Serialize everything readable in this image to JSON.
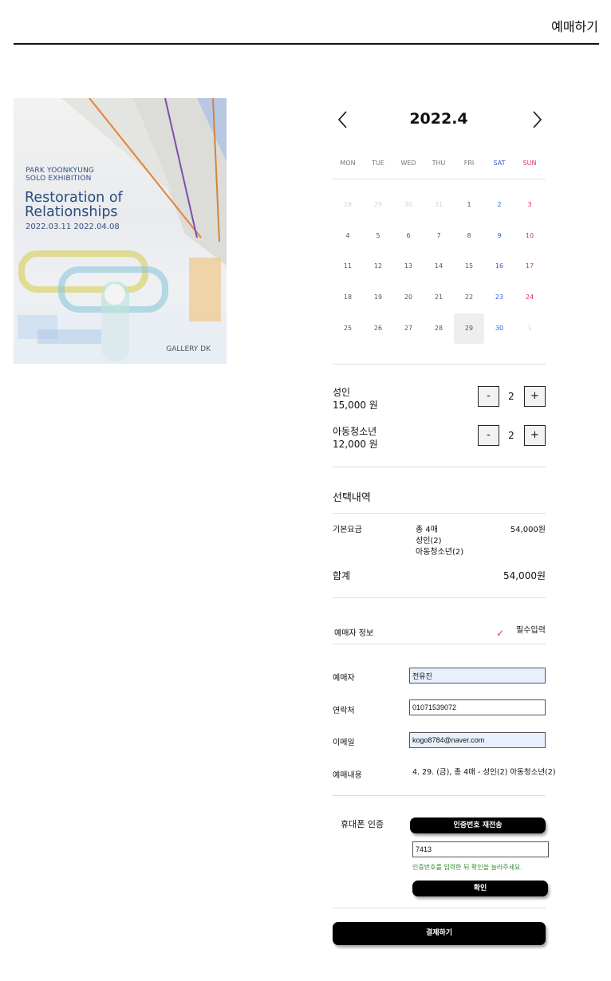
{
  "header": {
    "title": "예매하기"
  },
  "poster": {
    "line1": "PARK YOONKYUNG",
    "line2": "SOLO EXHIBITION",
    "title": "Restoration of Relationships",
    "dates": "2022.03.11  2022.04.08",
    "gallery": "GALLERY DK"
  },
  "calendar": {
    "month_label": "2022.4",
    "prev_icon": "chevron-left-icon",
    "next_icon": "chevron-right-icon",
    "weekdays": [
      "MON",
      "TUE",
      "WED",
      "THU",
      "FRI",
      "SAT",
      "SUN"
    ],
    "weeks": [
      [
        "28",
        "29",
        "30",
        "31",
        "1",
        "2",
        "3"
      ],
      [
        "4",
        "5",
        "6",
        "7",
        "8",
        "9",
        "10"
      ],
      [
        "11",
        "12",
        "13",
        "14",
        "15",
        "16",
        "17"
      ],
      [
        "18",
        "19",
        "20",
        "21",
        "22",
        "23",
        "24"
      ],
      [
        "25",
        "26",
        "27",
        "28",
        "29",
        "30",
        "1"
      ]
    ],
    "selected_date": "29",
    "colors": {
      "saturday": "#2f5bd6",
      "sunday": "#d9335c",
      "selected_bg": "#eeeeee"
    }
  },
  "tickets": {
    "adult": {
      "label": "성인",
      "price": "15,000 원",
      "minus": "-",
      "plus": "+",
      "count": "2"
    },
    "youth": {
      "label": "아동청소년",
      "price": "12,000 원",
      "minus": "-",
      "plus": "+",
      "count": "2"
    }
  },
  "summary": {
    "title": "선택내역",
    "base_label": "기본요금",
    "base_detail_1": "총 4매",
    "base_detail_2": "성인(2)",
    "base_detail_3": "아동청소년(2)",
    "base_amount": "54,000원",
    "total_label": "합계",
    "total_amount": "54,000원"
  },
  "booker": {
    "section_label": "예매자 정보",
    "required_mark": "✓",
    "required_label": "필수입력",
    "name_label": "예매자",
    "name_value": "전유진",
    "phone_label": "연락처",
    "phone_value": "01071539072",
    "email_label": "이메일",
    "email_value": "kogo8784@naver.com",
    "content_label": "예매내용",
    "content_value": "4. 29. (금), 총 4매 - 성인(2) 아동청소년(2)"
  },
  "verify": {
    "label": "휴대폰 인증",
    "resend_button": "인증번호 재전송",
    "code_value": "7413",
    "hint": "인증번호를 입력한 뒤 확인을 눌러주세요.",
    "confirm_button": "확인"
  },
  "pay_button": "결제하기"
}
